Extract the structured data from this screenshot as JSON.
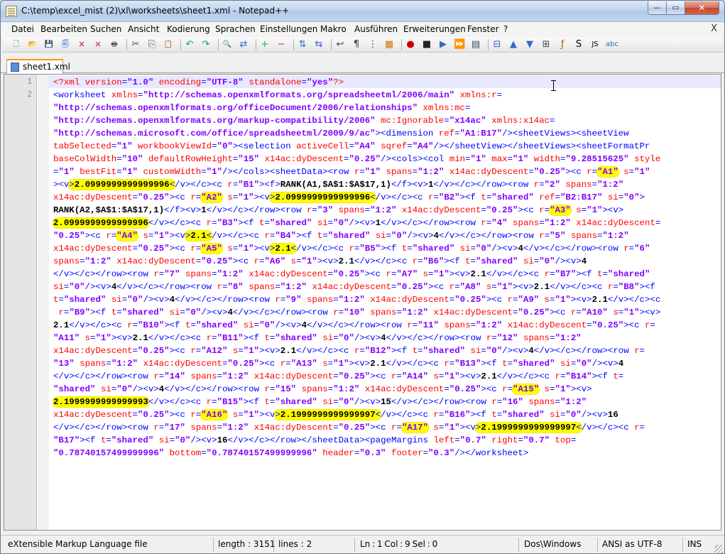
{
  "window": {
    "title": "C:\\temp\\excel_mist (2)\\xl\\worksheets\\sheet1.xml - Notepad++",
    "minimize_glyph": "—",
    "maximize_glyph": "▭",
    "close_glyph": "✕",
    "icon": "notepad-icon"
  },
  "menu": {
    "items": [
      "Datei",
      "Bearbeiten",
      "Suchen",
      "Ansicht",
      "Kodierung",
      "Sprachen",
      "Einstellungen",
      "Makro",
      "Ausführen",
      "Erweiterungen",
      "Fenster",
      "?"
    ],
    "close_doc": "X"
  },
  "toolbar": {
    "icons": [
      "new-file-icon",
      "open-file-icon",
      "save-icon",
      "save-all-icon",
      "close-icon",
      "close-all-icon",
      "print-icon",
      "cut-icon",
      "copy-icon",
      "paste-icon",
      "undo-icon",
      "redo-icon",
      "find-icon",
      "replace-icon",
      "zoom-in-icon",
      "zoom-out-icon",
      "sync-vertical-icon",
      "sync-horizontal-icon",
      "word-wrap-icon",
      "show-all-chars-icon",
      "indent-guide-icon",
      "doc-map-icon",
      "record-macro-icon",
      "stop-macro-icon",
      "play-macro-icon",
      "play-multiple-icon",
      "save-macro-icon",
      "fold-all-icon",
      "up-icon",
      "down-icon",
      "unfold-icon",
      "function-list-icon",
      "spell-icon",
      "jslint-icon",
      "abc-icon"
    ],
    "glyphs": [
      "🗋",
      "📂",
      "💾",
      "🗐",
      "🗙",
      "🗙",
      "🖶",
      "✂",
      "⎘",
      "📋",
      "↶",
      "↷",
      "🔍",
      "⇄",
      "+",
      "−",
      "⇅",
      "⇆",
      "↩",
      "¶",
      "⋮",
      "▦",
      "●",
      "■",
      "▶",
      "⏩",
      "▤",
      "⊟",
      "▲",
      "▼",
      "⊞",
      "ƒ",
      "S",
      "JS",
      "abc"
    ]
  },
  "tabs": [
    {
      "label": "sheet1.xml",
      "active": true
    }
  ],
  "editor": {
    "line_numbers": [
      "1",
      "2"
    ],
    "lines": [
      "<?xml version=\"1.0\" encoding=\"UTF-8\" standalone=\"yes\"?>",
      "<worksheet xmlns=\"http://schemas.openxmlformats.org/spreadsheetml/2006/main\" xmlns:r=",
      "\"http://schemas.openxmlformats.org/officeDocument/2006/relationships\" xmlns:mc=",
      "\"http://schemas.openxmlformats.org/markup-compatibility/2006\" mc:Ignorable=\"x14ac\" xmlns:x14ac=",
      "\"http://schemas.microsoft.com/office/spreadsheetml/2009/9/ac\"><dimension ref=\"A1:B17\"/><sheetViews><sheetView",
      "tabSelected=\"1\" workbookViewId=\"0\"><selection activeCell=\"A4\" sqref=\"A4\"/></sheetView></sheetViews><sheetFormatPr",
      "baseColWidth=\"10\" defaultRowHeight=\"15\" x14ac:dyDescent=\"0.25\"/><cols><col min=\"1\" max=\"1\" width=\"9.28515625\" style",
      "=\"1\" bestFit=\"1\" customWidth=\"1\"/></cols><sheetData><row r=\"1\" spans=\"1:2\" x14ac:dyDescent=\"0.25\"><c r=\"A1\" s=\"1\"",
      "><v>2.0999999999999996</v></c><c r=\"B1\"><f>RANK(A1,$A$1:$A$17,1)</f><v>1</v></c></row><row r=\"2\" spans=\"1:2\"",
      "x14ac:dyDescent=\"0.25\"><c r=\"A2\" s=\"1\"><v>2.0999999999999996</v></c><c r=\"B2\"><f t=\"shared\" ref=\"B2:B17\" si=\"0\">",
      "RANK(A2,$A$1:$A$17,1)</f><v>1</v></c></row><row r=\"3\" spans=\"1:2\" x14ac:dyDescent=\"0.25\"><c r=\"A3\" s=\"1\"><v>",
      "2.0999999999999996</v></c><c r=\"B3\"><f t=\"shared\" si=\"0\"/><v>1</v></c></row><row r=\"4\" spans=\"1:2\" x14ac:dyDescent=",
      "\"0.25\"><c r=\"A4\" s=\"1\"><v>2.1</v></c><c r=\"B4\"><f t=\"shared\" si=\"0\"/><v>4</v></c></row><row r=\"5\" spans=\"1:2\"",
      "x14ac:dyDescent=\"0.25\"><c r=\"A5\" s=\"1\"><v>2.1</v></c><c r=\"B5\"><f t=\"shared\" si=\"0\"/><v>4</v></c></row><row r=\"6\"",
      "spans=\"1:2\" x14ac:dyDescent=\"0.25\"><c r=\"A6\" s=\"1\"><v>2.1</v></c><c r=\"B6\"><f t=\"shared\" si=\"0\"/><v>4",
      "</v></c></row><row r=\"7\" spans=\"1:2\" x14ac:dyDescent=\"0.25\"><c r=\"A7\" s=\"1\"><v>2.1</v></c><c r=\"B7\"><f t=\"shared\"",
      "si=\"0\"/><v>4</v></c></row><row r=\"8\" spans=\"1:2\" x14ac:dyDescent=\"0.25\"><c r=\"A8\" s=\"1\"><v>2.1</v></c><c r=\"B8\"><f",
      "t=\"shared\" si=\"0\"/><v>4</v></c></row><row r=\"9\" spans=\"1:2\" x14ac:dyDescent=\"0.25\"><c r=\"A9\" s=\"1\"><v>2.1</v></c><c",
      " r=\"B9\"><f t=\"shared\" si=\"0\"/><v>4</v></c></row><row r=\"10\" spans=\"1:2\" x14ac:dyDescent=\"0.25\"><c r=\"A10\" s=\"1\"><v>",
      "2.1</v></c><c r=\"B10\"><f t=\"shared\" si=\"0\"/><v>4</v></c></row><row r=\"11\" spans=\"1:2\" x14ac:dyDescent=\"0.25\"><c r=",
      "\"A11\" s=\"1\"><v>2.1</v></c><c r=\"B11\"><f t=\"shared\" si=\"0\"/><v>4</v></c></row><row r=\"12\" spans=\"1:2\"",
      "x14ac:dyDescent=\"0.25\"><c r=\"A12\" s=\"1\"><v>2.1</v></c><c r=\"B12\"><f t=\"shared\" si=\"0\"/><v>4</v></c></row><row r=",
      "\"13\" spans=\"1:2\" x14ac:dyDescent=\"0.25\"><c r=\"A13\" s=\"1\"><v>2.1</v></c><c r=\"B13\"><f t=\"shared\" si=\"0\"/><v>4",
      "</v></c></row><row r=\"14\" spans=\"1:2\" x14ac:dyDescent=\"0.25\"><c r=\"A14\" s=\"1\"><v>2.1</v></c><c r=\"B14\"><f t=",
      "\"shared\" si=\"0\"/><v>4</v></c></row><row r=\"15\" spans=\"1:2\" x14ac:dyDescent=\"0.25\"><c r=\"A15\" s=\"1\"><v>",
      "2.1999999999999993</v></c><c r=\"B15\"><f t=\"shared\" si=\"0\"/><v>15</v></c></row><row r=\"16\" spans=\"1:2\"",
      "x14ac:dyDescent=\"0.25\"><c r=\"A16\" s=\"1\"><v>2.1999999999999997</v></c><c r=\"B16\"><f t=\"shared\" si=\"0\"/><v>16",
      "</v></c></row><row r=\"17\" spans=\"1:2\" x14ac:dyDescent=\"0.25\"><c r=\"A17\" s=\"1\"><v>2.1999999999999997</v></c><c r=",
      "\"B17\"><f t=\"shared\" si=\"0\"/><v>16</v></c></row></sheetData><pageMargins left=\"0.7\" right=\"0.7\" top=",
      "\"0.78740157499999996\" bottom=\"0.78740157499999996\" header=\"0.3\" footer=\"0.3\"/></worksheet>"
    ],
    "highlights": [
      "=\"A1\"",
      "=\"A2\"",
      "=\"A3\"",
      "=\"A4\"",
      "=\"A5\"",
      "=\"A15\"",
      "=\"A16\"",
      "=\"A17\"",
      ">2.0999999999999996<",
      ">2.1<",
      ">2.1999999999999997<",
      "2.0999999999999996<",
      "2.1999999999999993<",
      "=\"A4\"",
      ">2.1<"
    ],
    "highlight_color": "#ffff00"
  },
  "statusbar": {
    "filetype": "eXtensible Markup Language file",
    "length": "length : 3151",
    "lines": "lines : 2",
    "position": "Ln : 1    Col : 9    Sel : 0",
    "eol": "Dos\\Windows",
    "encoding": "ANSI as UTF-8",
    "mode": "INS"
  },
  "colors": {
    "tag": "#0000ff",
    "attribute": "#ff0000",
    "value": "#8000ff",
    "active_tab_accent": "#fa9900",
    "current_line": "#e8e8ff"
  }
}
